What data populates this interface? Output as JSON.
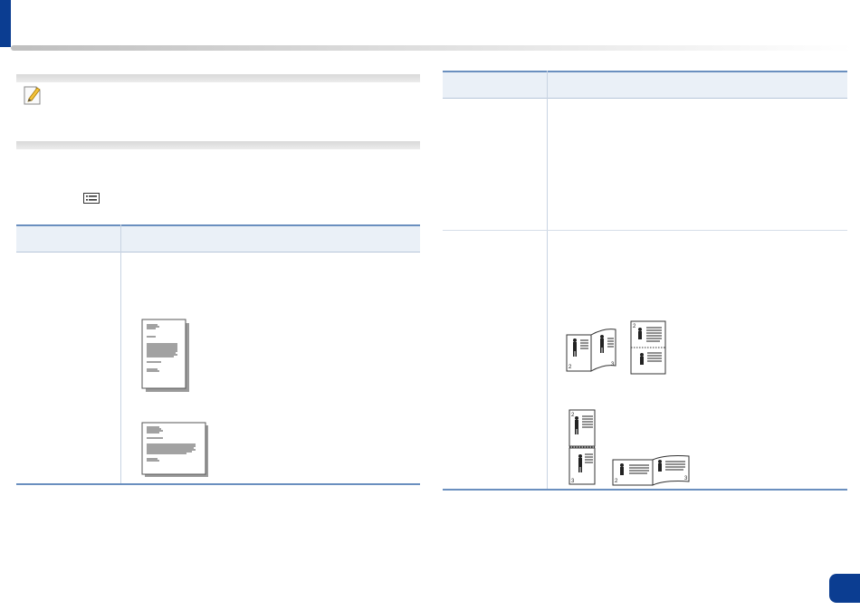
{
  "header": {
    "accent_color": "#0b3d91"
  },
  "note": {
    "icon": "note-pencil-icon"
  },
  "menu": {
    "icon": "menu-list-icon"
  },
  "table_left": {
    "rows": [
      {
        "illustrations": [
          "portrait-document-icon",
          "landscape-document-icon"
        ]
      }
    ]
  },
  "table_right": {
    "rows": [
      {
        "illustrations": []
      },
      {
        "illustrations": [
          "long-edge-binding-icon",
          "short-edge-binding-icon"
        ]
      }
    ]
  },
  "colors": {
    "table_rule": "#6a8fbf",
    "table_header_bg": "#eaf0f7"
  }
}
